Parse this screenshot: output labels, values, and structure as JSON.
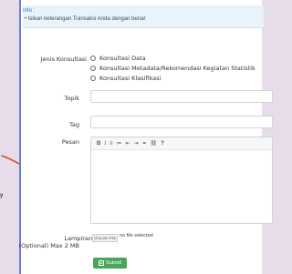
{
  "info": {
    "title": "Info :",
    "bullet": "• Isikan keterangan Transaksi Anda dengan benar"
  },
  "form": {
    "jenis_konsultasi_label": "Jenis Konsultasi",
    "options": [
      {
        "label": "Konsultasi Data"
      },
      {
        "label": "Konsultasi Metadata/Rekomendasi Kegiatan Statistik"
      },
      {
        "label": "Konsultasi Klasifikasi"
      }
    ],
    "topik_label": "Topik",
    "tag_label": "Tag",
    "pesan_label": "Pesan",
    "toolbar": {
      "bold": "B",
      "italic": "I",
      "ul": "≡",
      "ol": "≔",
      "indent_left": "⇤",
      "indent_right": "⇥",
      "link": "⚭",
      "unlink": "⛓",
      "help": "?"
    },
    "lampiran_label_line1": "Lampiran",
    "lampiran_label_line2": "(Optional) Max 2 MB",
    "file_button": "Choose File",
    "file_status": "no file selected",
    "submit_label": "Submit"
  },
  "edge": {
    "letter": "y"
  },
  "colors": {
    "accent": "#6b7fd0",
    "submit": "#4aa55a",
    "info_bg": "#eaf3fb",
    "page_bg": "#e7dcea",
    "doodle": "#c4512b"
  }
}
